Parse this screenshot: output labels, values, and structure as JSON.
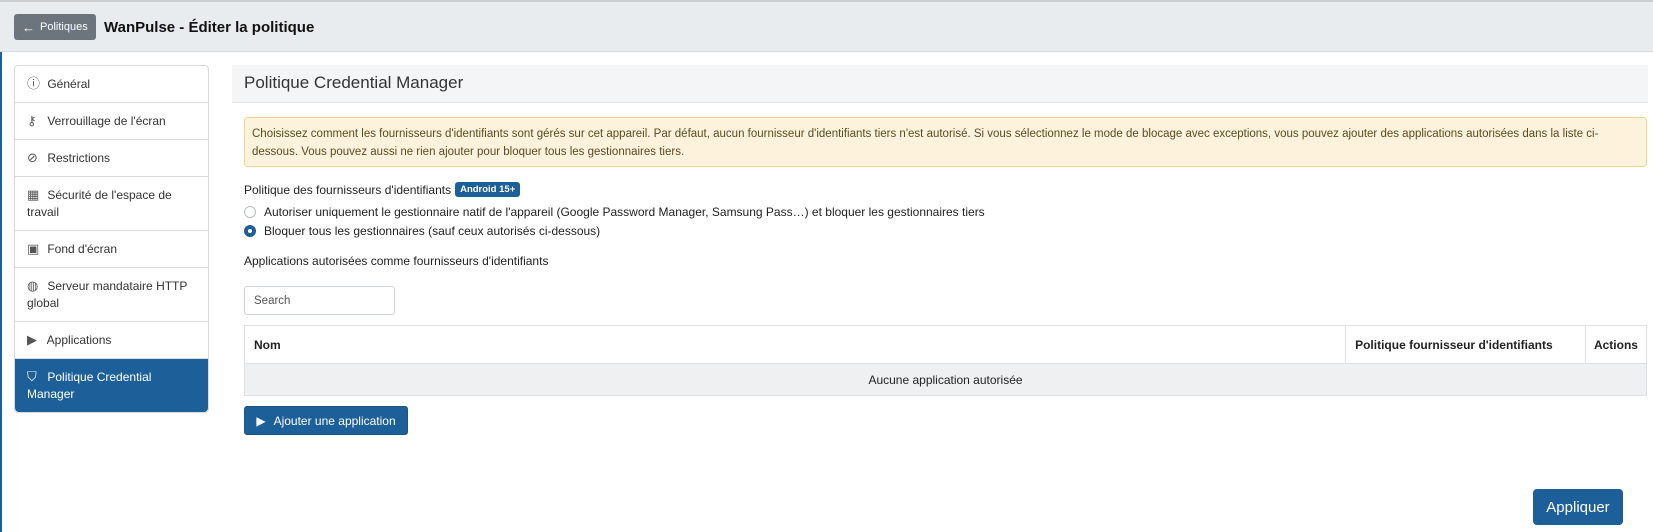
{
  "header": {
    "back_label": "Politiques",
    "title": "WanPulse - Éditer la politique"
  },
  "sidebar": {
    "items": [
      {
        "label": "Général",
        "icon": "info-icon"
      },
      {
        "label": "Verrouillage de l'écran",
        "icon": "key-icon"
      },
      {
        "label": "Restrictions",
        "icon": "ban-icon"
      },
      {
        "label": "Sécurité de l'espace de travail",
        "icon": "building-icon"
      },
      {
        "label": "Fond d'écran",
        "icon": "image-icon"
      },
      {
        "label": "Serveur mandataire HTTP global",
        "icon": "globe-icon"
      },
      {
        "label": "Applications",
        "icon": "play-store-icon"
      },
      {
        "label": "Politique Credential Manager",
        "icon": "shield-icon",
        "active": true
      }
    ]
  },
  "main": {
    "section_title": "Politique Credential Manager",
    "alert_text": "Choisissez comment les fournisseurs d'identifiants sont gérés sur cet appareil. Par défaut, aucun fournisseur d'identifiants tiers n'est autorisé. Si vous sélectionnez le mode de blocage avec exceptions, vous pouvez ajouter des applications autorisées dans la liste ci-dessous. Vous pouvez aussi ne rien ajouter pour bloquer tous les gestionnaires tiers.",
    "policy_label": "Politique des fournisseurs d'identifiants",
    "policy_badge": "Android 15+",
    "options": [
      {
        "label": "Autoriser uniquement le gestionnaire natif de l'appareil (Google Password Manager, Samsung Pass…) et bloquer les gestionnaires tiers",
        "checked": false
      },
      {
        "label": "Bloquer tous les gestionnaires (sauf ceux autorisés ci-dessous)",
        "checked": true
      }
    ],
    "apps_label": "Applications autorisées comme fournisseurs d'identifiants",
    "search_placeholder": "Search",
    "table": {
      "columns": [
        "Nom",
        "Politique fournisseur d'identifiants",
        "Actions"
      ],
      "empty_text": "Aucune application autorisée"
    },
    "add_button": "Ajouter une application",
    "apply_button": "Appliquer"
  },
  "colors": {
    "primary": "#1d5f98",
    "alert_bg": "#fdf3dc",
    "header_bg": "#e9ecef"
  }
}
